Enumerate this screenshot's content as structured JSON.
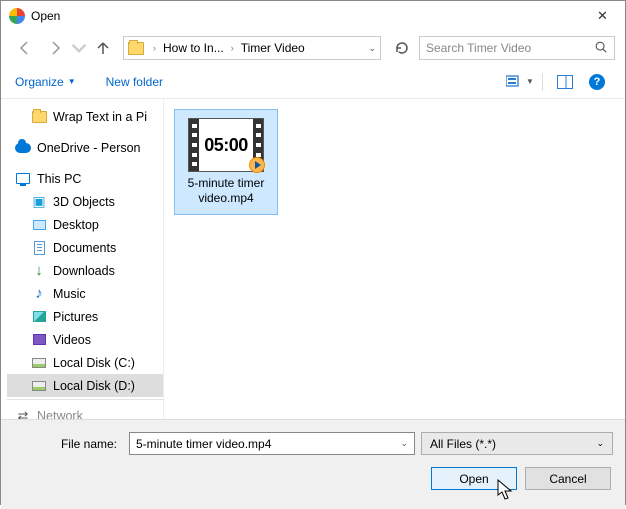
{
  "window": {
    "title": "Open"
  },
  "breadcrumbs": {
    "item0": "How to In...",
    "item1": "Timer Video"
  },
  "search": {
    "placeholder": "Search Timer Video"
  },
  "toolbar": {
    "organize": "Organize",
    "newfolder": "New folder"
  },
  "tree": {
    "wrap": "Wrap Text in a Pi",
    "onedrive": "OneDrive - Person",
    "thispc": "This PC",
    "threed": "3D Objects",
    "desktop": "Desktop",
    "documents": "Documents",
    "downloads": "Downloads",
    "music": "Music",
    "pictures": "Pictures",
    "videos": "Videos",
    "localc": "Local Disk (C:)",
    "locald": "Local Disk (D:)",
    "network": "Network"
  },
  "file": {
    "thumb_text": "05:00",
    "name_line1": "5-minute timer",
    "name_line2": "video.mp4"
  },
  "bottom": {
    "fn_label": "File name:",
    "fn_value": "5-minute timer video.mp4",
    "filter": "All Files (*.*)",
    "open": "Open",
    "cancel": "Cancel"
  }
}
